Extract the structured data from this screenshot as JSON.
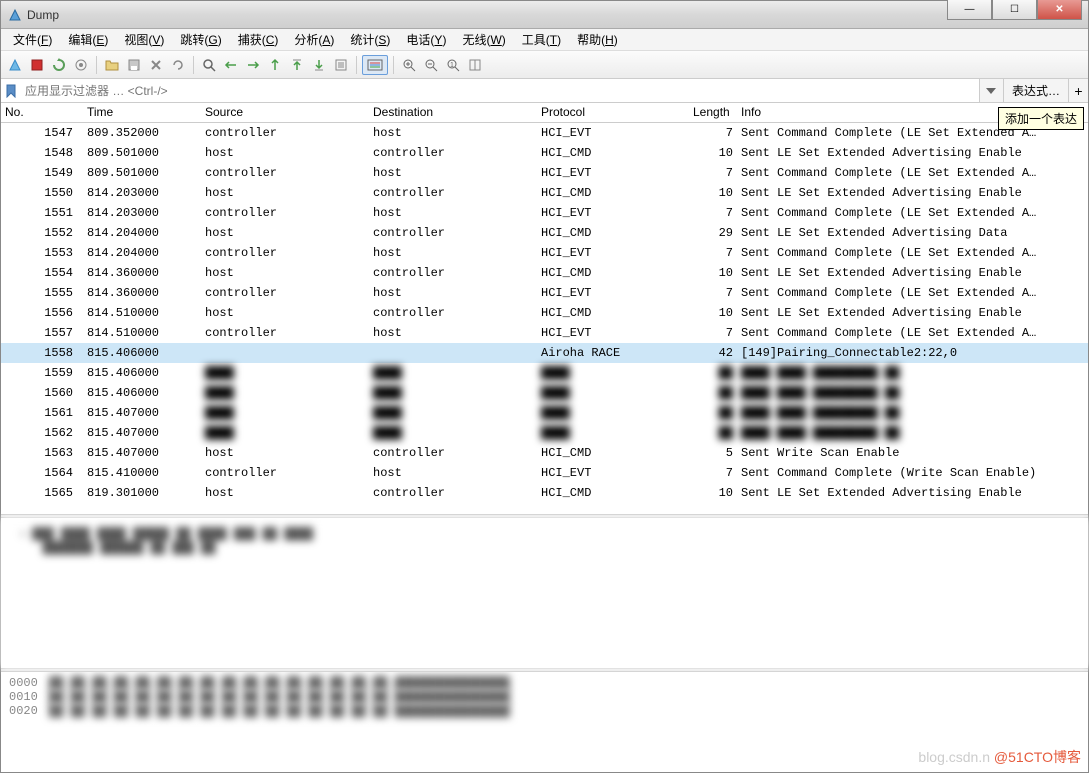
{
  "window": {
    "title": "Dump"
  },
  "window_controls": {
    "min": "—",
    "max": "☐",
    "close": "✕"
  },
  "menu": [
    {
      "label": "文件",
      "key": "F"
    },
    {
      "label": "编辑",
      "key": "E"
    },
    {
      "label": "视图",
      "key": "V"
    },
    {
      "label": "跳转",
      "key": "G"
    },
    {
      "label": "捕获",
      "key": "C"
    },
    {
      "label": "分析",
      "key": "A"
    },
    {
      "label": "统计",
      "key": "S"
    },
    {
      "label": "电话",
      "key": "Y"
    },
    {
      "label": "无线",
      "key": "W"
    },
    {
      "label": "工具",
      "key": "T"
    },
    {
      "label": "帮助",
      "key": "H"
    }
  ],
  "filter": {
    "placeholder": "应用显示过滤器 … <Ctrl-/>",
    "expression_label": "表达式…",
    "plus": "+",
    "tooltip": "添加一个表达"
  },
  "columns": {
    "no": "No.",
    "time": "Time",
    "source": "Source",
    "destination": "Destination",
    "protocol": "Protocol",
    "length": "Length",
    "info": "Info"
  },
  "packets": [
    {
      "no": "1547",
      "time": "809.352000",
      "src": "controller",
      "dst": "host",
      "proto": "HCI_EVT",
      "len": "7",
      "info": "Sent Command Complete (LE Set Extended A…"
    },
    {
      "no": "1548",
      "time": "809.501000",
      "src": "host",
      "dst": "controller",
      "proto": "HCI_CMD",
      "len": "10",
      "info": "Sent LE Set Extended Advertising Enable"
    },
    {
      "no": "1549",
      "time": "809.501000",
      "src": "controller",
      "dst": "host",
      "proto": "HCI_EVT",
      "len": "7",
      "info": "Sent Command Complete (LE Set Extended A…"
    },
    {
      "no": "1550",
      "time": "814.203000",
      "src": "host",
      "dst": "controller",
      "proto": "HCI_CMD",
      "len": "10",
      "info": "Sent LE Set Extended Advertising Enable"
    },
    {
      "no": "1551",
      "time": "814.203000",
      "src": "controller",
      "dst": "host",
      "proto": "HCI_EVT",
      "len": "7",
      "info": "Sent Command Complete (LE Set Extended A…"
    },
    {
      "no": "1552",
      "time": "814.204000",
      "src": "host",
      "dst": "controller",
      "proto": "HCI_CMD",
      "len": "29",
      "info": "Sent LE Set Extended Advertising Data"
    },
    {
      "no": "1553",
      "time": "814.204000",
      "src": "controller",
      "dst": "host",
      "proto": "HCI_EVT",
      "len": "7",
      "info": "Sent Command Complete (LE Set Extended A…"
    },
    {
      "no": "1554",
      "time": "814.360000",
      "src": "host",
      "dst": "controller",
      "proto": "HCI_CMD",
      "len": "10",
      "info": "Sent LE Set Extended Advertising Enable"
    },
    {
      "no": "1555",
      "time": "814.360000",
      "src": "controller",
      "dst": "host",
      "proto": "HCI_EVT",
      "len": "7",
      "info": "Sent Command Complete (LE Set Extended A…"
    },
    {
      "no": "1556",
      "time": "814.510000",
      "src": "host",
      "dst": "controller",
      "proto": "HCI_CMD",
      "len": "10",
      "info": "Sent LE Set Extended Advertising Enable"
    },
    {
      "no": "1557",
      "time": "814.510000",
      "src": "controller",
      "dst": "host",
      "proto": "HCI_EVT",
      "len": "7",
      "info": "Sent Command Complete (LE Set Extended A…"
    },
    {
      "no": "1558",
      "time": "815.406000",
      "src": "",
      "dst": "",
      "proto": "Airoha RACE",
      "len": "42",
      "info": "[149]Pairing_Connectable2:22,0",
      "selected": true
    },
    {
      "no": "1559",
      "time": "815.406000",
      "src": "",
      "dst": "",
      "proto": "",
      "len": "",
      "info": "",
      "blur": true
    },
    {
      "no": "1560",
      "time": "815.406000",
      "src": "",
      "dst": "",
      "proto": "",
      "len": "",
      "info": "",
      "blur": true
    },
    {
      "no": "1561",
      "time": "815.407000",
      "src": "",
      "dst": "",
      "proto": "",
      "len": "",
      "info": "",
      "blur": true
    },
    {
      "no": "1562",
      "time": "815.407000",
      "src": "",
      "dst": "",
      "proto": "",
      "len": "",
      "info": "",
      "blur": true
    },
    {
      "no": "1563",
      "time": "815.407000",
      "src": "host",
      "dst": "controller",
      "proto": "HCI_CMD",
      "len": "5",
      "info": "Sent Write Scan Enable"
    },
    {
      "no": "1564",
      "time": "815.410000",
      "src": "controller",
      "dst": "host",
      "proto": "HCI_EVT",
      "len": "7",
      "info": "Sent Command Complete (Write Scan Enable)"
    },
    {
      "no": "1565",
      "time": "819.301000",
      "src": "host",
      "dst": "controller",
      "proto": "HCI_CMD",
      "len": "10",
      "info": "Sent LE Set Extended Advertising Enable"
    }
  ],
  "byte_offsets": [
    "0000",
    "0010",
    "0020"
  ],
  "watermark": {
    "text1": "blog.csdn.n",
    "text2": "@51CTO博客"
  }
}
